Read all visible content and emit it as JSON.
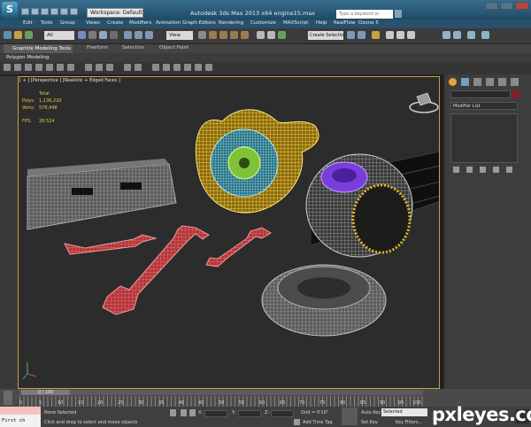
{
  "titlebar": {
    "logo": "S",
    "workspace": "Workspace: Default",
    "window_title": "Autodesk 3ds Max 2013 x64   engine15.max",
    "search_placeholder": "Type a keyword or phrase"
  },
  "menu": [
    "Edit",
    "Tools",
    "Group",
    "Views",
    "Create",
    "Modifiers",
    "Animation",
    "Graph Editors",
    "Rendering",
    "Customize",
    "MAXScript",
    "Help",
    "RealFlow",
    "Ozone 5"
  ],
  "toolbar": {
    "filter": "All",
    "view": "View",
    "selection_set": "Create Selection Se"
  },
  "ribbon": {
    "tabs": [
      "Graphite Modeling Tools",
      "Freeform",
      "Selection",
      "Object Paint"
    ],
    "group": "Polygon Modeling"
  },
  "viewport": {
    "label": "[ + ] [Perspective ] [Realistic + Edged Faces ]",
    "stats": {
      "total_label": "Total",
      "polys_label": "Polys:",
      "polys": "1,136,220",
      "verts_label": "Verts:",
      "verts": "578,448",
      "fps_label": "FPS:",
      "fps": "28.524"
    }
  },
  "command_panel": {
    "modifier_list": "Modifier List"
  },
  "timeline": {
    "frame": "0 / 100",
    "ticks": [
      "0",
      "5",
      "10",
      "15",
      "20",
      "25",
      "30",
      "35",
      "40",
      "45",
      "50",
      "55",
      "60",
      "65",
      "70",
      "75",
      "80",
      "85",
      "90",
      "95",
      "100"
    ]
  },
  "status": {
    "listener": "First ch",
    "selection": "None Selected",
    "prompt": "Click and drag to select and move objects",
    "x_label": "X:",
    "y_label": "Y:",
    "z_label": "Z:",
    "grid": "Grid = 0'10\"",
    "add_time_tag": "Add Time Tag",
    "auto_key": "Auto Key",
    "set_key": "Set Key",
    "key_mode": "Selected",
    "key_filters": "Key Filters..."
  },
  "watermark": "pxleyes.com",
  "colors": {
    "title": "#1f4a66",
    "viewport_border": "#c8a23a",
    "turbo": "#e2b52a",
    "brake": "#5aa8c0",
    "wrench": "#d6484a",
    "alternator": "#7a3fd8"
  }
}
